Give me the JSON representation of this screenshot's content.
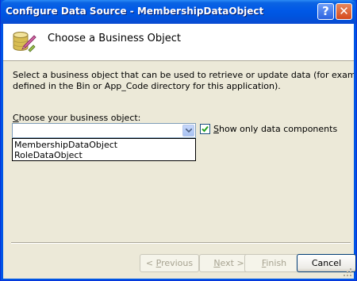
{
  "window": {
    "title": "Configure Data Source - MembershipDataObject",
    "help_glyph": "?",
    "close_glyph": "✕"
  },
  "header": {
    "icon": "database-wizard-icon",
    "title": "Choose a Business Object"
  },
  "description": "Select a business object that can be used to retrieve or update data (for example, an obj\ndefined in the Bin or App_Code directory for this application).",
  "business_object": {
    "label_accesskey": "C",
    "label_rest": "hoose your business object:",
    "value": "",
    "options": [
      "MembershipDataObject",
      "RoleDataObject"
    ]
  },
  "show_only_data_components": {
    "checked": true,
    "label_accesskey": "S",
    "label_rest": "how only data components"
  },
  "buttons": {
    "previous": {
      "prefix": "< ",
      "accesskey": "P",
      "rest": "revious",
      "enabled": false
    },
    "next": {
      "accesskey": "N",
      "rest": "ext >",
      "enabled": false
    },
    "finish": {
      "accesskey": "F",
      "rest": "inish",
      "enabled": false
    },
    "cancel": {
      "label": "Cancel",
      "enabled": true
    }
  },
  "colors": {
    "titlebar": "#0054e3",
    "face": "#ece9d8",
    "header_bg": "#ffffff",
    "disabled_text": "#a7a391",
    "button_border": "#003c74"
  }
}
